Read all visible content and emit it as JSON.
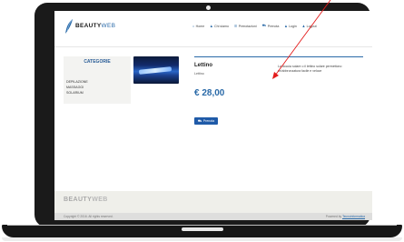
{
  "site": {
    "logo": {
      "strong": "BEAUTY",
      "rest": "WEB"
    },
    "nav": [
      {
        "icon": "home-icon",
        "glyph": "⌂",
        "label": "Home"
      },
      {
        "icon": "user-icon",
        "glyph": "♟",
        "label": "Chi siamo"
      },
      {
        "icon": "list-icon",
        "glyph": "☰",
        "label": "Prenotazioni"
      },
      {
        "icon": "cart-icon",
        "glyph": "⛟",
        "label": "Prenota"
      },
      {
        "icon": "login-icon",
        "glyph": "♟",
        "label": "Login"
      },
      {
        "icon": "user-icon",
        "glyph": "♟",
        "label": "Logout"
      }
    ]
  },
  "sidebar": {
    "title": "CATEGORIE",
    "items": [
      "DEPILAZIONE",
      "MASSAGGI",
      "SOLARIUM"
    ]
  },
  "product": {
    "name": "Lettino",
    "subtitle": "Lettino",
    "description": "La doccia solare o il lettino solare permettono un'abbronzatura facile e veloce",
    "price": "€ 28,00",
    "button": "Prenota"
  },
  "footer": {
    "logo": {
      "strong": "BEAUTY",
      "rest": "WEB"
    },
    "copyright": "Copyright © 2016. All rights reserved.",
    "powered_prefix": "Powered by",
    "powered_link": "Tecnoinformatica"
  },
  "annotation": {
    "color": "#e41b1b"
  }
}
